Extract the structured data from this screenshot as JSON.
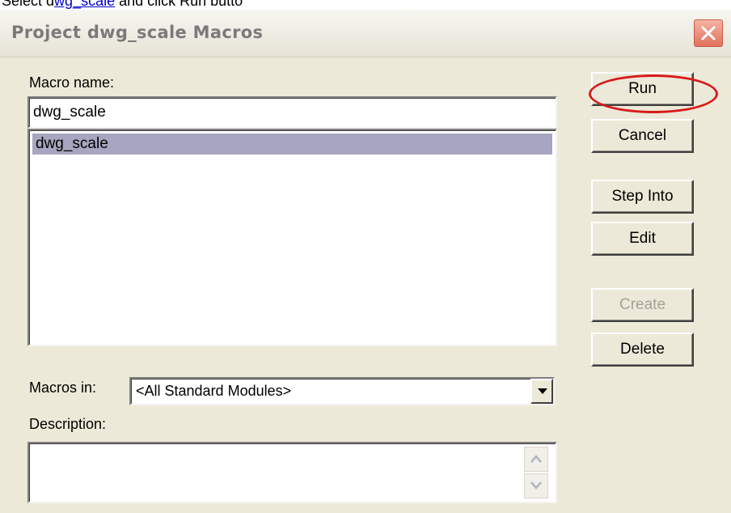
{
  "instruction": {
    "prefix": "Select d",
    "link": "wg_scale",
    "suffix": " and click Run butto"
  },
  "window": {
    "title": "Project dwg_scale Macros",
    "close_icon": "close-icon"
  },
  "form": {
    "macro_name_label": "Macro name:",
    "macro_name_value": "dwg_scale",
    "macro_list": [
      "dwg_scale"
    ],
    "selected_index": 0,
    "macros_in_label": "Macros in:",
    "macros_in_value": "<All Standard Modules>",
    "description_label": "Description:",
    "description_value": ""
  },
  "buttons": {
    "run": "Run",
    "cancel": "Cancel",
    "step_into": "Step Into",
    "edit": "Edit",
    "create": "Create",
    "delete": "Delete"
  },
  "colors": {
    "highlight_circle": "#d81a1a",
    "selection": "#a6a6c0",
    "dialog_bg": "#ece9d8"
  }
}
